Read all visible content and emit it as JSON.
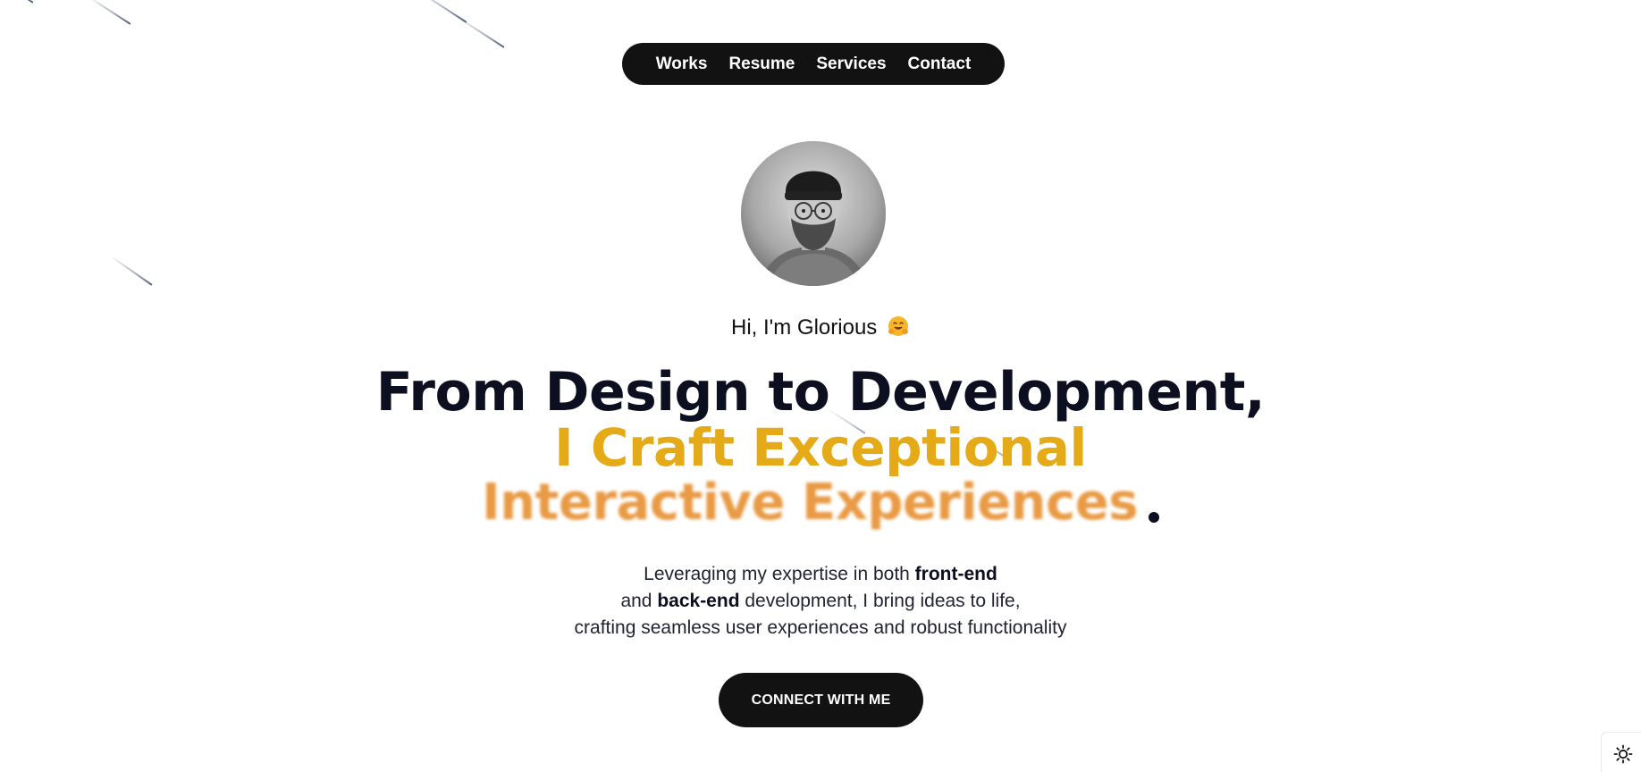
{
  "nav": {
    "items": [
      {
        "label": "Works"
      },
      {
        "label": "Resume"
      },
      {
        "label": "Services"
      },
      {
        "label": "Contact"
      }
    ]
  },
  "hero": {
    "greeting": "Hi, I'm Glorious",
    "greeting_emoji": "hugging-face-emoji",
    "headline_line1": "From Design to Development,",
    "headline_line2": "I Craft Exceptional",
    "headline_line3": "Interactive Experiences",
    "subtitle": {
      "line1_text": "Leveraging my expertise in both ",
      "line1_bold": "front-end",
      "line2_pre": "and ",
      "line2_bold": "back-end",
      "line2_post": " development, I bring ideas to life,",
      "line3_text": "crafting seamless user experiences and robust functionality"
    },
    "cta_label": "CONNECT WITH ME"
  },
  "theme_toggle": {
    "icon": "sun-icon"
  },
  "colors": {
    "accent_gold": "#e5aa17",
    "accent_orange": "#e8953a",
    "dark": "#121212"
  }
}
